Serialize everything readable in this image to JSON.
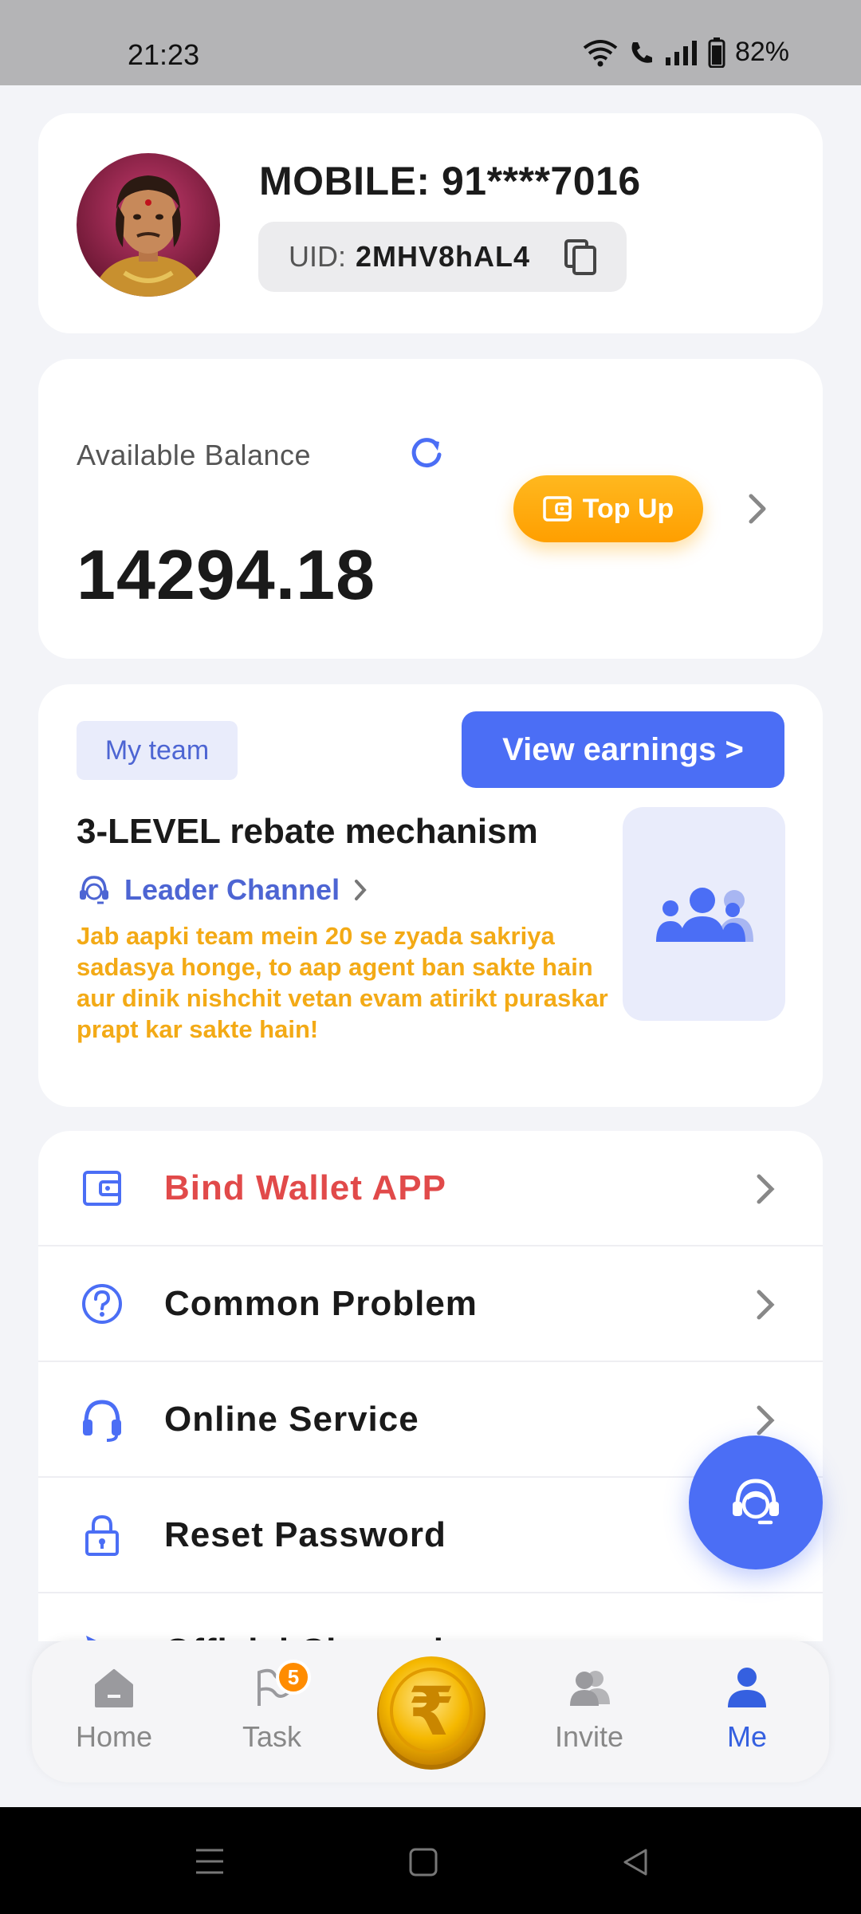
{
  "status_bar": {
    "time": "21:23",
    "battery": "82%"
  },
  "profile": {
    "mobile": "MOBILE: 91****7016",
    "uid_label": "UID:",
    "uid_value": "2MHV8hAL4"
  },
  "balance": {
    "label": "Available Balance",
    "value": "14294.18",
    "topup_label": "Top Up"
  },
  "team": {
    "tag": "My team",
    "view_earnings": "View earnings >",
    "title": "3-LEVEL rebate mechanism",
    "leader_channel": "Leader Channel",
    "description": "Jab aapki team mein 20 se zyada sakriya sadasya honge, to aap agent ban sakte hain aur dinik nishchit vetan evam atirikt puraskar prapt kar sakte hain!"
  },
  "menu": {
    "items": [
      {
        "label": "Bind Wallet APP",
        "icon": "wallet-icon"
      },
      {
        "label": "Common Problem",
        "icon": "question-icon"
      },
      {
        "label": "Online Service",
        "icon": "headset-icon"
      },
      {
        "label": "Reset Password",
        "icon": "lock-icon"
      },
      {
        "label": "Official Channel",
        "icon": "send-icon"
      }
    ]
  },
  "nav": {
    "home": "Home",
    "task": "Task",
    "task_badge": "5",
    "invite": "Invite",
    "me": "Me"
  },
  "colors": {
    "accent": "#4b6ef5",
    "warning": "#f3aa16",
    "danger": "#e14a4a",
    "topup": "#ffa500"
  }
}
